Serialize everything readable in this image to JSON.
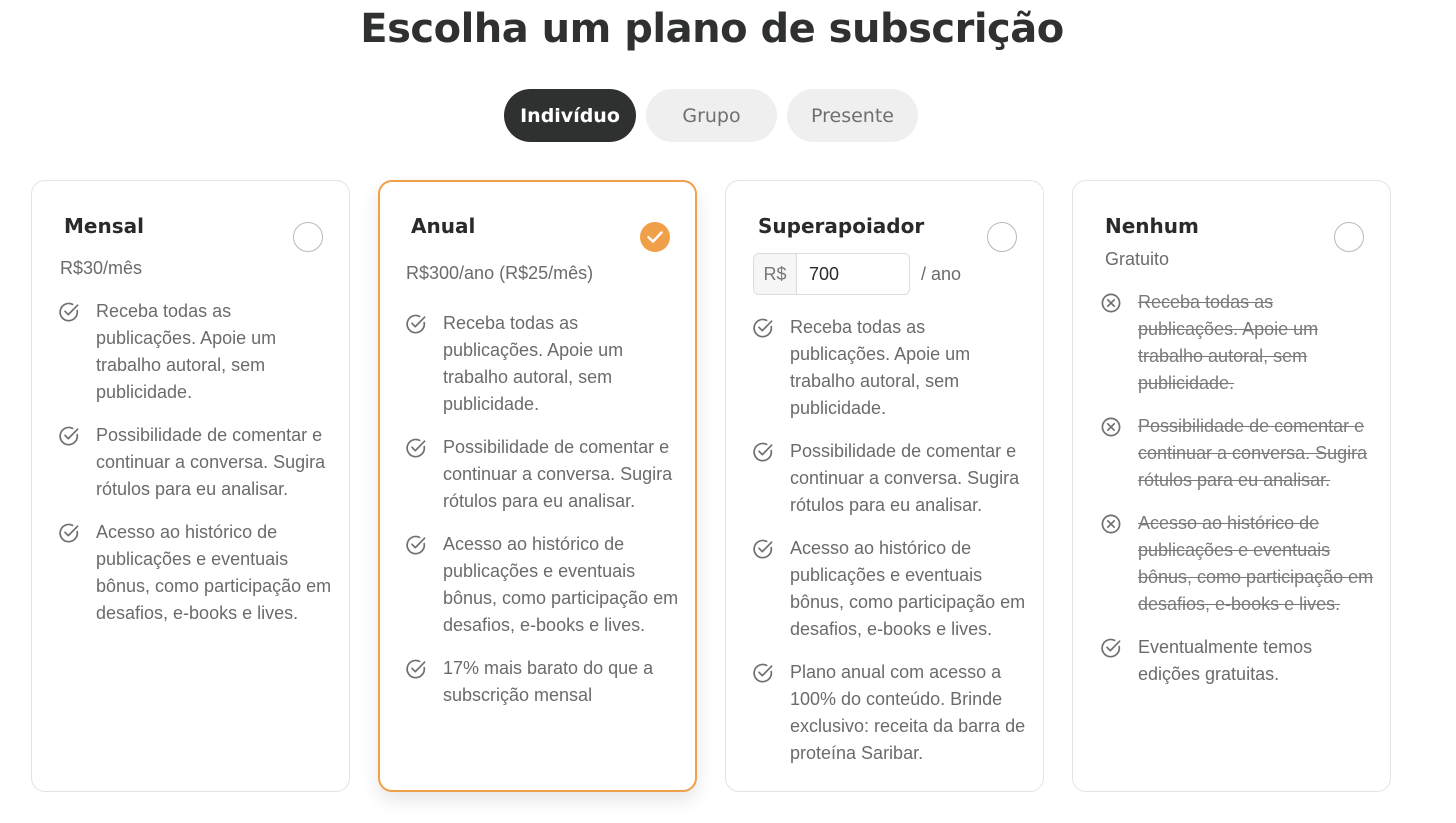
{
  "page": {
    "title": "Escolha um plano de subscrição"
  },
  "tabs": [
    {
      "label": "Indivíduo",
      "active": true
    },
    {
      "label": "Grupo",
      "active": false
    },
    {
      "label": "Presente",
      "active": false
    }
  ],
  "colors": {
    "accent": "#f0a048",
    "dark": "#2f3030",
    "muted_text": "#6b6b6b"
  },
  "plans": [
    {
      "name": "Mensal",
      "price": "R$30/mês",
      "selected": false,
      "features": [
        {
          "text": "Receba todas as publicações. Apoie um trabalho autoral, sem publicidade.",
          "included": true
        },
        {
          "text": "Possibilidade de comentar e continuar a conversa. Sugira rótulos para eu analisar.",
          "included": true
        },
        {
          "text": "Acesso ao histórico de publicações e eventuais bônus, como participação em desafios, e-books e lives.",
          "included": true
        }
      ]
    },
    {
      "name": "Anual",
      "price": "R$300/ano (R$25/mês)",
      "selected": true,
      "features": [
        {
          "text": "Receba todas as publicações. Apoie um trabalho autoral, sem publicidade.",
          "included": true
        },
        {
          "text": "Possibilidade de comentar e continuar a conversa. Sugira rótulos para eu analisar.",
          "included": true
        },
        {
          "text": "Acesso ao histórico de publicações e eventuais bônus, como participação em desafios, e-books e lives.",
          "included": true
        },
        {
          "text": "17% mais barato do que a subscrição mensal",
          "included": true
        }
      ]
    },
    {
      "name": "Superapoiador",
      "currency": "R$",
      "amount": "700",
      "period": "/ ano",
      "selected": false,
      "features": [
        {
          "text": "Receba todas as publicações. Apoie um trabalho autoral, sem publicidade.",
          "included": true
        },
        {
          "text": "Possibilidade de comentar e continuar a conversa. Sugira rótulos para eu analisar.",
          "included": true
        },
        {
          "text": "Acesso ao histórico de publicações e eventuais bônus, como participação em desafios, e-books e lives.",
          "included": true
        },
        {
          "text": "Plano anual com acesso a 100% do conteúdo. Brinde exclusivo: receita da barra de proteína Saribar.",
          "included": true
        }
      ]
    },
    {
      "name": "Nenhum",
      "price": "Gratuito",
      "selected": false,
      "features": [
        {
          "text": "Receba todas as publicações. Apoie um trabalho autoral, sem publicidade.",
          "included": false
        },
        {
          "text": "Possibilidade de comentar e continuar a conversa. Sugira rótulos para eu analisar.",
          "included": false
        },
        {
          "text": "Acesso ao histórico de publicações e eventuais bônus, como participação em desafios, e-books e lives.",
          "included": false
        },
        {
          "text": "Eventualmente temos edições gratuitas.",
          "included": true
        }
      ]
    }
  ]
}
